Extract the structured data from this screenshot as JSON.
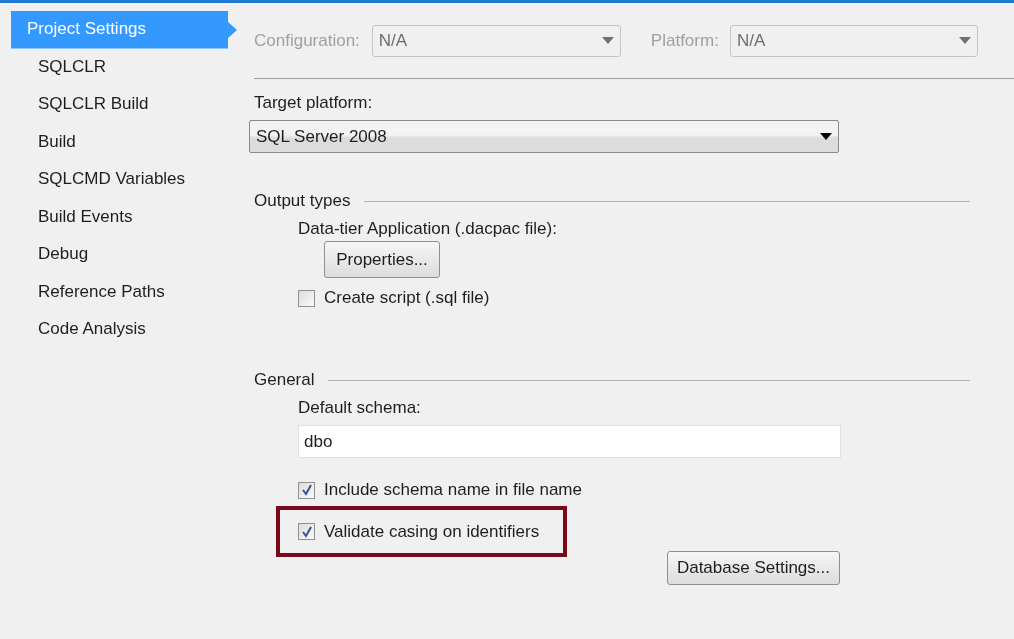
{
  "sidebar": {
    "items": [
      {
        "label": "Project Settings",
        "selected": true
      },
      {
        "label": "SQLCLR",
        "selected": false
      },
      {
        "label": "SQLCLR Build",
        "selected": false
      },
      {
        "label": "Build",
        "selected": false
      },
      {
        "label": "SQLCMD Variables",
        "selected": false
      },
      {
        "label": "Build Events",
        "selected": false
      },
      {
        "label": "Debug",
        "selected": false
      },
      {
        "label": "Reference Paths",
        "selected": false
      },
      {
        "label": "Code Analysis",
        "selected": false
      }
    ]
  },
  "toolbar": [
    {
      "label": "Configuration:",
      "value": "N/A",
      "disabled": true
    },
    {
      "label": "Platform:",
      "value": "N/A",
      "disabled": true
    }
  ],
  "target_platform": {
    "label": "Target platform:",
    "value": "SQL Server 2008"
  },
  "output_types": {
    "heading": "Output types",
    "dacpac_label": "Data-tier Application (.dacpac file):",
    "properties_button": "Properties...",
    "checkboxes": [
      {
        "label": "Create script (.sql file)",
        "checked": false,
        "highlighted": false
      }
    ]
  },
  "general": {
    "heading": "General",
    "schema_label": "Default schema:",
    "schema_value": "dbo",
    "checkboxes": [
      {
        "label": "Include schema name in file name",
        "checked": true,
        "highlighted": false
      },
      {
        "label": "Validate casing on identifiers",
        "checked": true,
        "highlighted": true
      }
    ],
    "database_settings_button": "Database Settings..."
  }
}
